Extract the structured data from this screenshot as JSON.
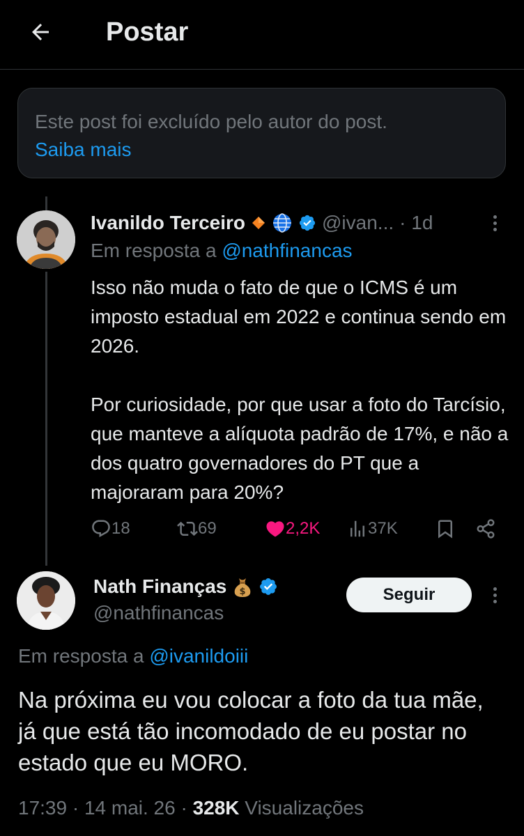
{
  "header": {
    "title": "Postar"
  },
  "deleted_notice": {
    "text": "Este post foi excluído pelo autor do post.",
    "link": "Saiba mais"
  },
  "reply_post": {
    "author_name": "Ivanildo Terceiro",
    "author_handle": "@ivan...",
    "time": "· 1d",
    "reply_prefix": "Em resposta a ",
    "reply_to": "@nathfinancas",
    "paragraphs": [
      "Isso não muda o fato de que o ICMS é um imposto estadual em 2022 e continua sendo em 2026.",
      "Por curiosidade, por que usar a foto do Tarcísio, que manteve a alíquota padrão de 17%, e não a dos quatro governadores do PT que a majoraram para 20%?"
    ],
    "stats": {
      "replies": "18",
      "reposts": "69",
      "likes": "2,2K",
      "views": "37K"
    }
  },
  "main_post": {
    "author_name": "Nath Finanças",
    "author_handle": "@nathfinancas",
    "follow_label": "Seguir",
    "reply_prefix": "Em resposta a ",
    "reply_to": "@ivanildoiii",
    "text": "Na próxima eu vou colocar a foto da tua mãe, já que está tão incomodado de eu postar no estado que eu MORO.",
    "timestamp": "17:39 · 14 mai. 26 · ",
    "views_count": "328K",
    "views_label": " Visualizações"
  },
  "colors": {
    "background": "#000000",
    "accent_blue": "#1d9bf0",
    "like_pink": "#f91880",
    "secondary_text": "#71767b",
    "primary_text": "#e7e9ea"
  }
}
